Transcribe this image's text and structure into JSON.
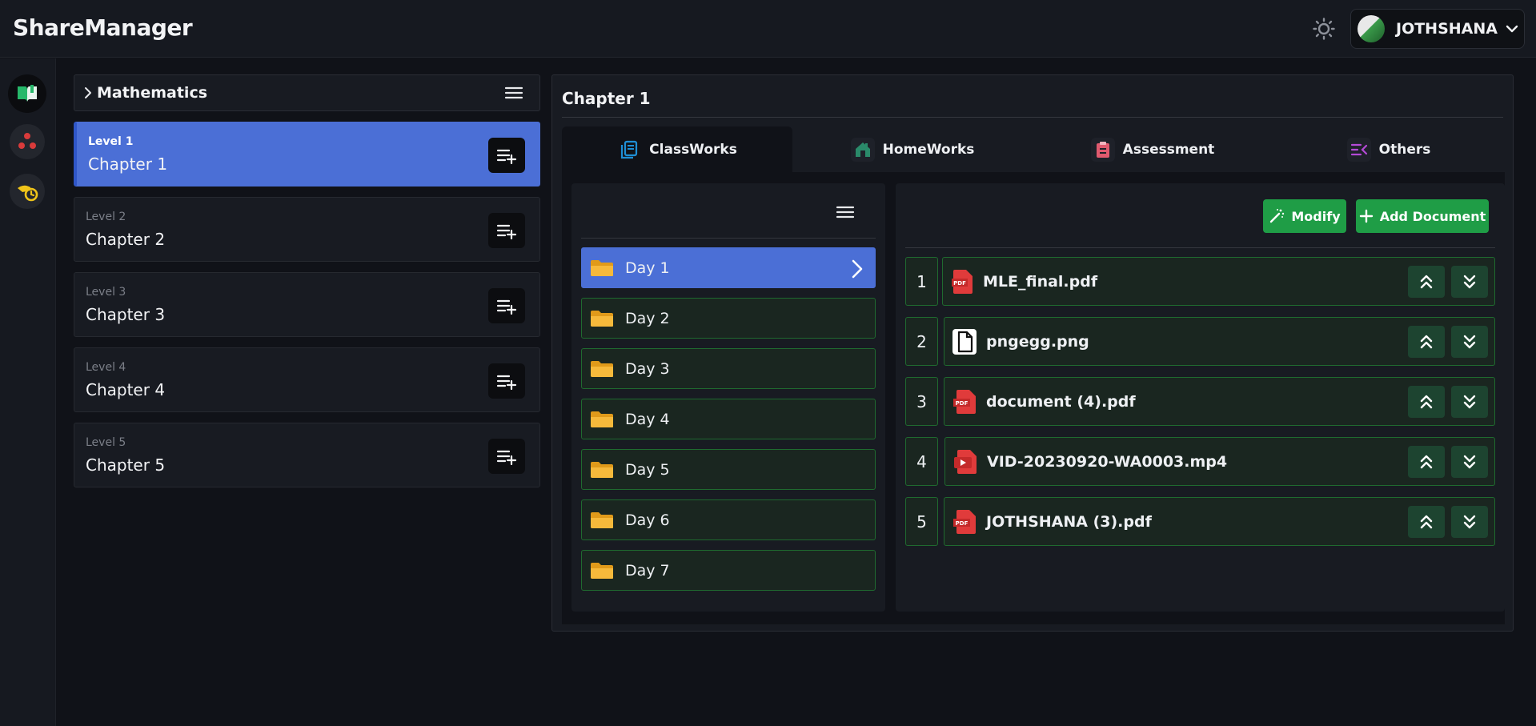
{
  "app": {
    "title": "ShareManager"
  },
  "user": {
    "name": "JOTHSHANA"
  },
  "subject": {
    "name": "Mathematics"
  },
  "levels": [
    {
      "level": "Level 1",
      "chapter": "Chapter 1",
      "active": true
    },
    {
      "level": "Level 2",
      "chapter": "Chapter 2",
      "active": false
    },
    {
      "level": "Level 3",
      "chapter": "Chapter 3",
      "active": false
    },
    {
      "level": "Level 4",
      "chapter": "Chapter 4",
      "active": false
    },
    {
      "level": "Level 5",
      "chapter": "Chapter 5",
      "active": false
    }
  ],
  "chapter": {
    "title": "Chapter 1"
  },
  "tabs": [
    {
      "label": "ClassWorks",
      "icon": "classworks-icon",
      "active": true,
      "color": "#1e8fd6"
    },
    {
      "label": "HomeWorks",
      "icon": "homeworks-icon",
      "active": false,
      "color": "#2a8a6a"
    },
    {
      "label": "Assessment",
      "icon": "assessment-icon",
      "active": false,
      "color": "#e05a6e"
    },
    {
      "label": "Others",
      "icon": "others-icon",
      "active": false,
      "color": "#b44ad6"
    }
  ],
  "days": [
    "Day 1",
    "Day 2",
    "Day 3",
    "Day 4",
    "Day 5",
    "Day 6",
    "Day 7"
  ],
  "actions": {
    "modify": "Modify",
    "add_document": "Add Document"
  },
  "documents": [
    {
      "index": "1",
      "name": "MLE_final.pdf",
      "type": "pdf"
    },
    {
      "index": "2",
      "name": "pngegg.png",
      "type": "file"
    },
    {
      "index": "3",
      "name": "document (4).pdf",
      "type": "pdf"
    },
    {
      "index": "4",
      "name": "VID-20230920-WA0003.mp4",
      "type": "video"
    },
    {
      "index": "5",
      "name": "JOTHSHANA (3).pdf",
      "type": "pdf"
    }
  ],
  "colors": {
    "accent_blue": "#4b6fd6",
    "success_green": "#1f9d46",
    "row_border_green": "#1f6a2f",
    "background": "#101218",
    "panel": "#181b22"
  }
}
